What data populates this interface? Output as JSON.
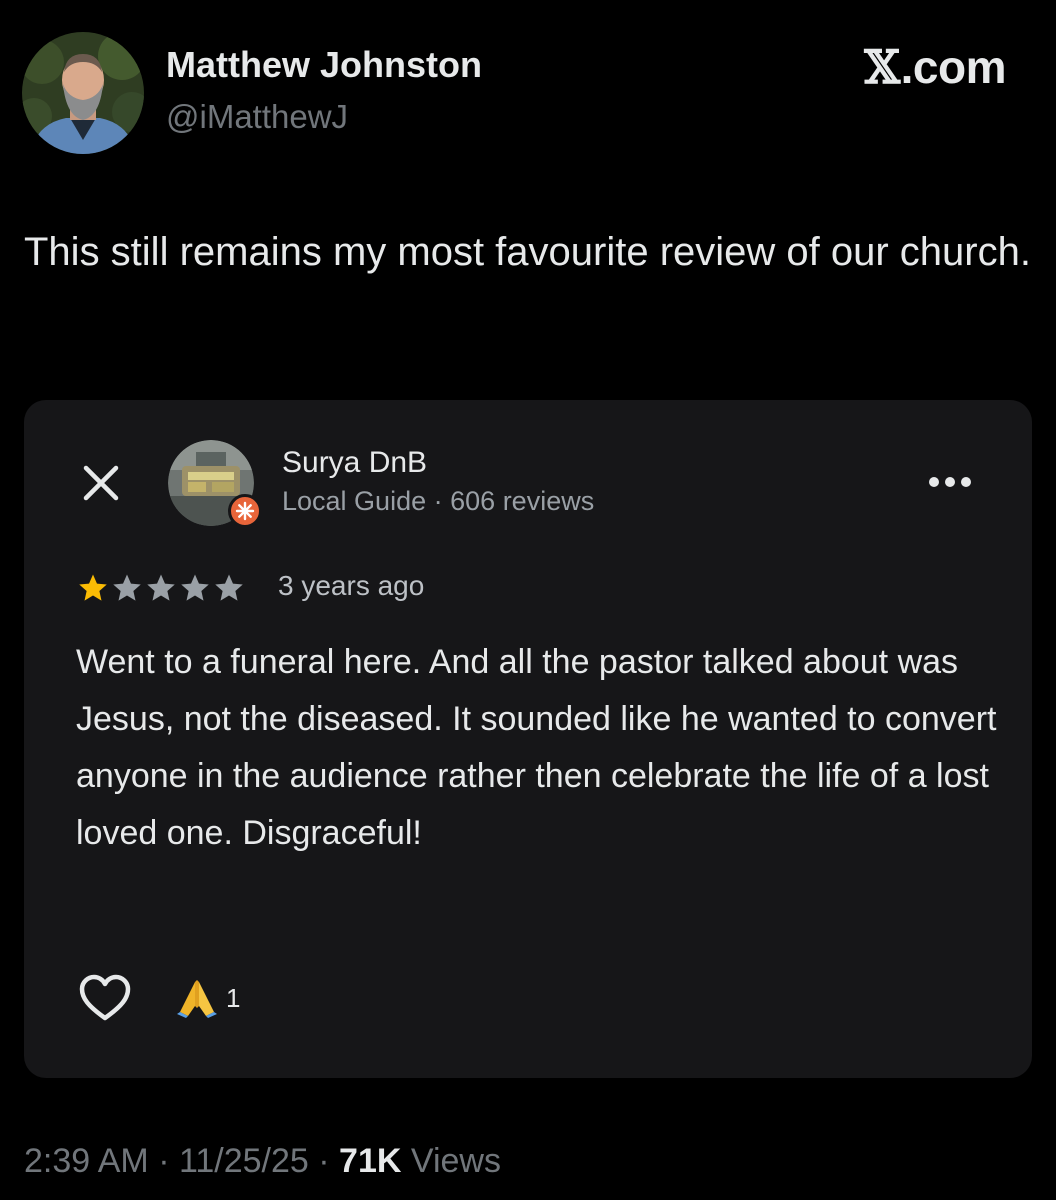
{
  "tweet": {
    "author_name": "Matthew Johnston",
    "author_handle": "@iMatthewJ",
    "brand_x": "𝕏",
    "brand_domain": ".com",
    "text": "This still remains my most favourite review of our church.",
    "time": "2:39 AM",
    "separator": "·",
    "date": "11/25/25",
    "views_count": "71K",
    "views_label": "Views"
  },
  "review": {
    "reviewer_name": "Surya DnB",
    "reviewer_badge": "Local Guide",
    "meta_separator": "·",
    "reviewer_reviews": "606 reviews",
    "rating": 1,
    "rating_max": 5,
    "age": "3 years ago",
    "body": "Went to a funeral here. And all the pastor talked about was Jesus, not the diseased. It sounded like he wanted to convert anyone in the audience rather then celebrate the life of a lost loved one. Disgraceful!",
    "reaction_emoji": "🙏",
    "reaction_count": "1"
  },
  "icons": {
    "close": "close-icon",
    "more": "more-horizontal-icon",
    "like": "heart-outline-icon",
    "star": "star-icon",
    "guide_badge": "local-guide-badge-icon"
  },
  "colors": {
    "background": "#000000",
    "card": "#161618",
    "primary_text": "#e7e9ea",
    "secondary_text": "#71767b",
    "star_filled": "#fbbc04",
    "star_empty": "#9aa0a6",
    "badge": "#e8653a"
  }
}
